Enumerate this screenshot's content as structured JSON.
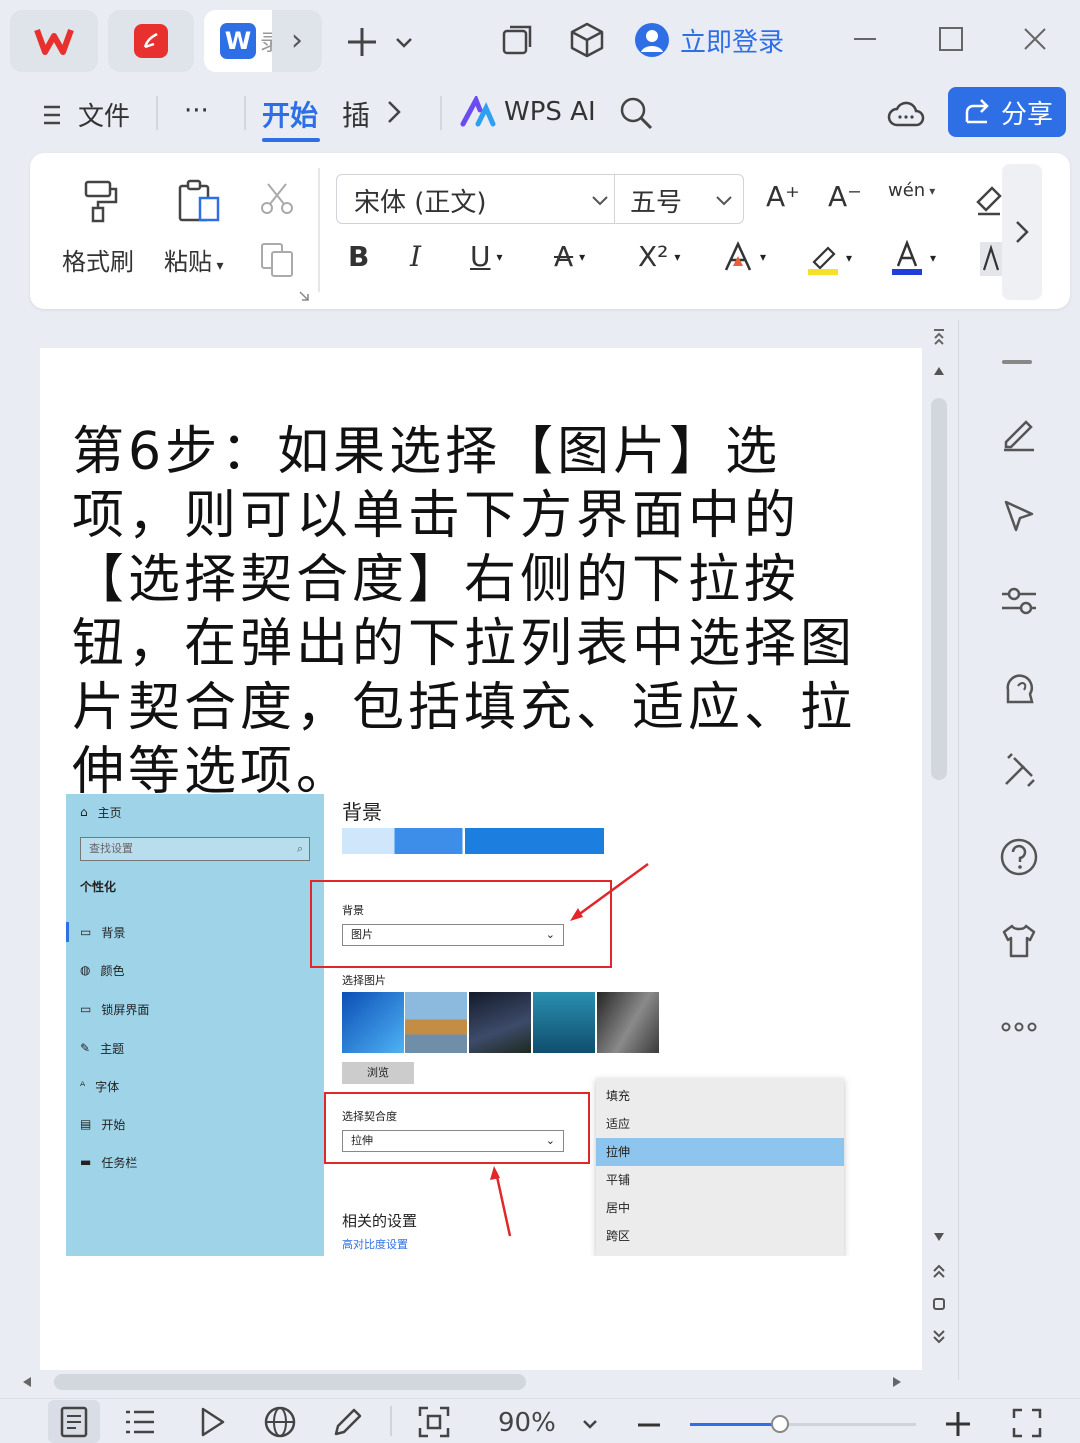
{
  "titlebar": {
    "login_label": "立即登录",
    "doc_tab_initial": "W",
    "doc_tab_trunc": "录"
  },
  "menu": {
    "file_label": "文件",
    "more_label": "···",
    "tabs": [
      {
        "label": "开始",
        "active": true
      },
      {
        "label": "插",
        "active": false
      }
    ],
    "wps_ai_label": "WPS AI",
    "share_label": "分享"
  },
  "ribbon": {
    "format_painter_label": "格式刷",
    "paste_label": "粘贴",
    "font_name": "宋体 (正文)",
    "font_size": "五号",
    "bold": "B",
    "italic": "I",
    "underline": "U",
    "strike": "A",
    "superscript": "X²",
    "increase_font": "A⁺",
    "decrease_font": "A⁻",
    "phonetic": "wén"
  },
  "document": {
    "heading": "第6步：如果选择【图片】选项，则可以单击下方界面中的【选择契合度】右侧的下拉按钮，在弹出的下拉列表中选择图片契合度，包括填充、适应、拉伸等选项。",
    "screenshot": {
      "sidebar": {
        "home": "主页",
        "search_placeholder": "查找设置",
        "section": "个性化",
        "items": [
          "背景",
          "颜色",
          "锁屏界面",
          "主题",
          "字体",
          "开始",
          "任务栏"
        ]
      },
      "main": {
        "title": "背景",
        "bg_label": "背景",
        "bg_value": "图片",
        "choose_picture": "选择图片",
        "browse": "浏览",
        "fit_label": "选择契合度",
        "fit_value": "拉伸",
        "related": "相关的设置",
        "contrast_link": "高对比度设置"
      },
      "dropdown": {
        "options": [
          "填充",
          "适应",
          "拉伸",
          "平铺",
          "居中",
          "跨区"
        ],
        "selected": "拉伸"
      }
    }
  },
  "statusbar": {
    "zoom": "90%",
    "zoom_fraction": 0.4
  },
  "colors": {
    "accent": "#2f6fe6",
    "red_annotation": "#e0272a",
    "settings_sidebar": "#9fd3e8",
    "dropdown_selected": "#8ec5ef"
  }
}
